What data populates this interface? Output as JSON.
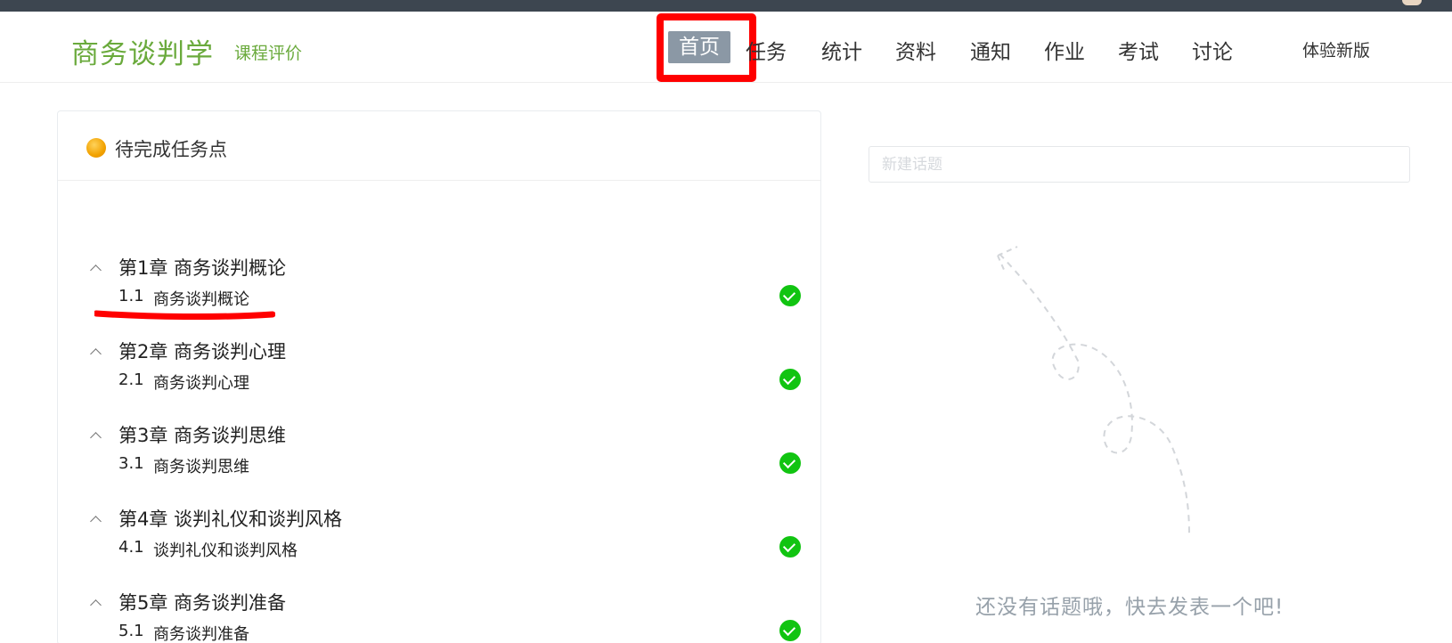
{
  "course": {
    "title": "商务谈判学",
    "evaluation": "课程评价"
  },
  "nav": {
    "items": [
      "首页",
      "任务",
      "统计",
      "资料",
      "通知",
      "作业",
      "考试",
      "讨论"
    ],
    "new_version": "体验新版"
  },
  "tasks": {
    "title": "待完成任务点",
    "chapters": [
      {
        "title": "第1章 商务谈判概论",
        "section_num": "1.1",
        "section_title": "商务谈判概论"
      },
      {
        "title": "第2章 商务谈判心理",
        "section_num": "2.1",
        "section_title": "商务谈判心理"
      },
      {
        "title": "第3章 商务谈判思维",
        "section_num": "3.1",
        "section_title": "商务谈判思维"
      },
      {
        "title": "第4章 谈判礼仪和谈判风格",
        "section_num": "4.1",
        "section_title": "谈判礼仪和谈判风格"
      },
      {
        "title": "第5章 商务谈判准备",
        "section_num": "5.1",
        "section_title": "商务谈判准备"
      }
    ]
  },
  "discussion": {
    "placeholder": "新建话题",
    "empty_text": "还没有话题哦，快去发表一个吧!"
  },
  "colors": {
    "brand_green": "#6aaa3c",
    "active_nav_bg": "#8b98a5",
    "highlight_red": "#ff0000",
    "check_green": "#11c411",
    "topbar": "#3d4650"
  },
  "icons": [
    "orange-dot-icon",
    "chevron-up-icon",
    "check-circle-icon"
  ]
}
